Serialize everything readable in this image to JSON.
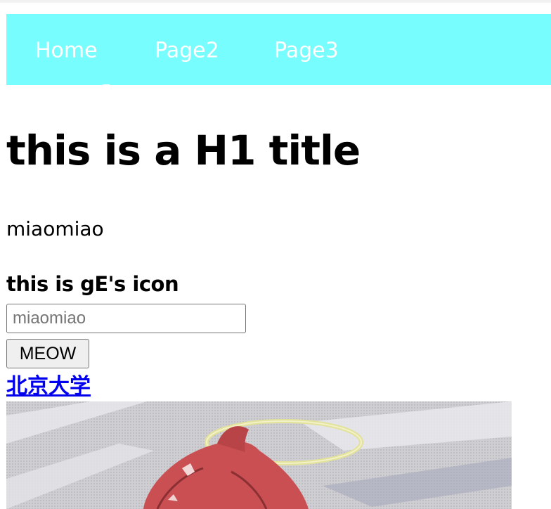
{
  "nav": {
    "items": [
      {
        "label": "Home"
      },
      {
        "label": "Page2"
      },
      {
        "label": "Page3"
      }
    ],
    "background_color": "#78fdff",
    "text_color": "#ffffff"
  },
  "main": {
    "title": "this is a H1 title",
    "paragraph": "miaomiao",
    "subheading": "this is gE's icon",
    "search_input": {
      "value": "",
      "placeholder": "miaomiao"
    },
    "button_label": "MEOW",
    "link_text": "北京大学",
    "link_color": "#0000ee",
    "image": {
      "icon_name": "anime-character-with-halo-image"
    }
  }
}
